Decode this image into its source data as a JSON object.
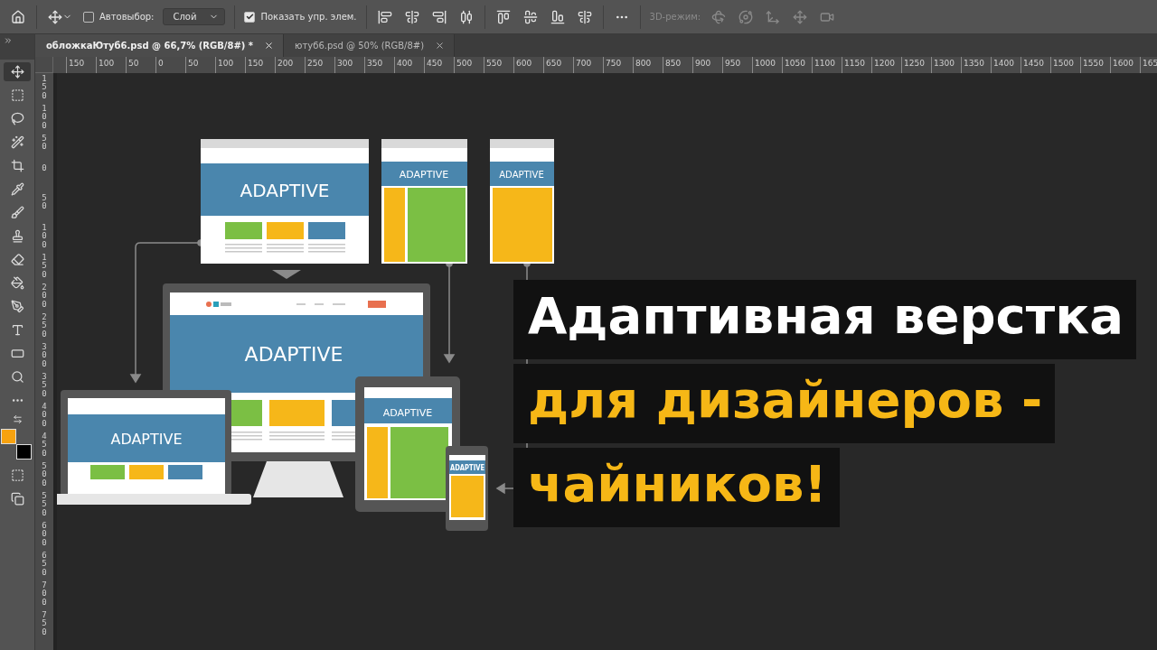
{
  "options_bar": {
    "auto_select": {
      "label": "Автовыбор:",
      "checked": false
    },
    "layer_select": {
      "value": "Слой"
    },
    "show_controls": {
      "label": "Показать упр. элем.",
      "checked": true
    },
    "mode_label": "3D-режим:"
  },
  "tabs": [
    {
      "label": "обложкаЮтуб6.psd @ 66,7% (RGB/8#) *",
      "selected": true
    },
    {
      "label": "ютуб6.psd @ 50% (RGB/8#)",
      "selected": false
    }
  ],
  "ruler_h": [
    "150",
    "100",
    "50",
    "0",
    "50",
    "100",
    "150",
    "200",
    "250",
    "300",
    "350",
    "400",
    "450",
    "500",
    "550",
    "600",
    "650",
    "700",
    "750",
    "800",
    "850",
    "900",
    "950",
    "1000",
    "1050",
    "1100",
    "1150",
    "1200",
    "1250",
    "1300",
    "1350",
    "1400",
    "1450",
    "1500",
    "1550",
    "1600",
    "165"
  ],
  "ruler_v": [
    "150",
    "100",
    "50",
    "0",
    "50",
    "100",
    "150",
    "200",
    "250",
    "300",
    "350",
    "400",
    "450",
    "500",
    "550",
    "600",
    "650",
    "700",
    "750"
  ],
  "swatches": [
    {
      "kind": "foreground",
      "color": "#f7a20f"
    },
    {
      "kind": "background",
      "color": "#000000"
    }
  ],
  "canvas": {
    "illustration": {
      "hero_texts": [
        "ADAPTIVE",
        "ADAPTIVE",
        "ADAPTIVE",
        "ADAPTIVE",
        "ADAPTIVE",
        "ADAPTIVE",
        "ADAPTIVE"
      ]
    },
    "headline": [
      {
        "text": "Адаптивная верстка",
        "color": "#ffffff"
      },
      {
        "text": "для дизайнеров -",
        "color": "#f6b716"
      },
      {
        "text": "чайников!",
        "color": "#f6b716"
      }
    ]
  }
}
